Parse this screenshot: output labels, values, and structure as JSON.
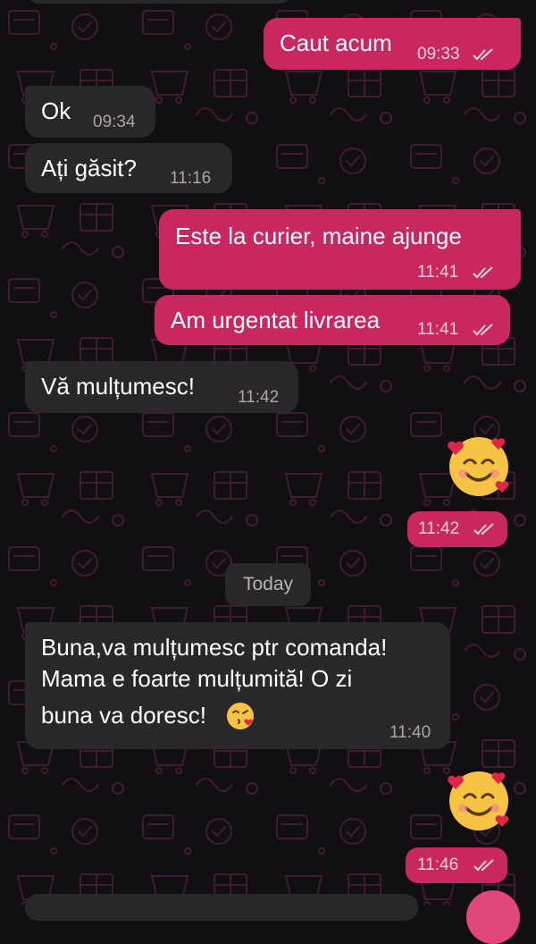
{
  "messages": [
    {
      "dir": "out",
      "text": "Caut acum",
      "time": "09:33",
      "status": "read"
    },
    {
      "dir": "in",
      "text": "Ok",
      "time": "09:34"
    },
    {
      "dir": "in",
      "text": "Ați găsit?",
      "time": "11:16"
    },
    {
      "dir": "out",
      "text": "Este la curier, maine ajunge",
      "time": "11:41",
      "status": "read"
    },
    {
      "dir": "out",
      "text": "Am urgentat livrarea",
      "time": "11:41",
      "status": "read"
    },
    {
      "dir": "in",
      "text": "Vă mulțumesc!",
      "time": "11:42"
    },
    {
      "dir": "out",
      "emoji": "smiling-face-with-hearts",
      "time": "11:42",
      "status": "read"
    },
    {
      "dir": "in",
      "lines": [
        "Buna,va mulțumesc ptr comanda!",
        "Mama e foarte mulțumită! O zi",
        "buna va doresc!"
      ],
      "inline_emoji": "face-blowing-a-kiss",
      "time": "11:40"
    },
    {
      "dir": "out",
      "emoji": "smiling-face-with-hearts",
      "time": "11:46",
      "status": "read"
    }
  ],
  "date_divider": "Today",
  "colors": {
    "background": "#120f12",
    "outgoing_bubble": "#c8275f",
    "incoming_bubble": "#2a272a",
    "pattern": "#4a2236"
  }
}
